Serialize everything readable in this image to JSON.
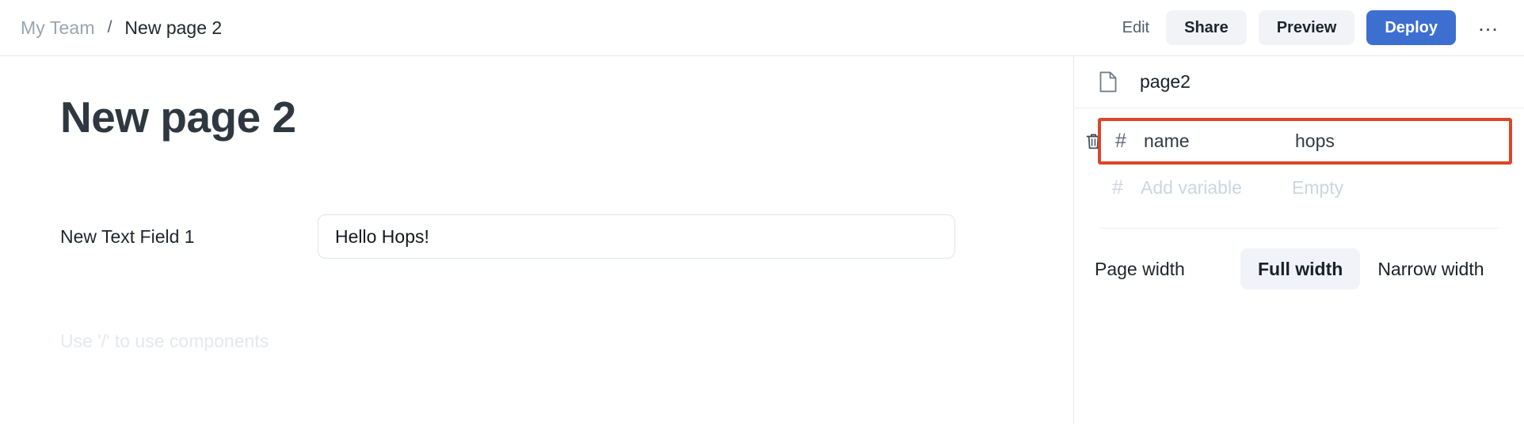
{
  "topbar": {
    "breadcrumb": {
      "team": "My Team",
      "separator": "/",
      "page": "New page 2"
    },
    "actions": {
      "edit": "Edit",
      "share": "Share",
      "preview": "Preview",
      "deploy": "Deploy",
      "more": "…"
    },
    "accent_color": "#3d6fd0"
  },
  "canvas": {
    "page_title": "New page 2",
    "field": {
      "label": "New Text Field 1",
      "value": "Hello Hops!",
      "placeholder": "Hello Hops!"
    },
    "slash_hint": "Use '/' to use components"
  },
  "sidebar": {
    "header": {
      "icon": "document-icon",
      "name": "page2"
    },
    "variables": [
      {
        "icon": "hash-icon",
        "name": "name",
        "value": "hops",
        "highlighted": true,
        "deletable": true
      },
      {
        "icon": "hash-icon",
        "name": "Add variable",
        "value": "Empty",
        "highlighted": false,
        "deletable": false
      }
    ],
    "highlight_color": "#dc4528",
    "page_width": {
      "label": "Page width",
      "options": [
        "Full width",
        "Narrow width"
      ],
      "selected": "Full width"
    }
  }
}
